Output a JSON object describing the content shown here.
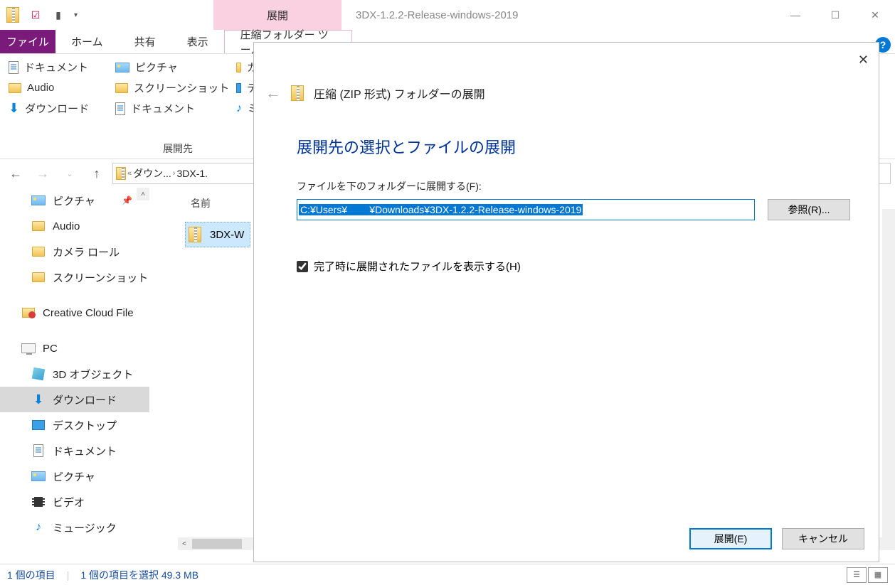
{
  "titlebar": {
    "contextual_tab": "展開",
    "window_title": "3DX-1.2.2-Release-windows-2019"
  },
  "ribbon": {
    "file_tab": "ファイル",
    "tabs": [
      "ホーム",
      "共有",
      "表示"
    ],
    "context_tab": "圧縮フォルダー ツール",
    "destinations": {
      "col1": [
        "ドキュメント",
        "Audio",
        "ダウンロード"
      ],
      "col2": [
        "ピクチャ",
        "スクリーンショット",
        "ドキュメント"
      ],
      "col3_cut": [
        "カ",
        "テ",
        "ミ"
      ]
    },
    "group_label": "展開先"
  },
  "breadcrumb": {
    "segments": [
      "ダウン... ",
      "3DX-1."
    ],
    "prefix": "«"
  },
  "tree": {
    "items": [
      {
        "label": "ピクチャ",
        "icon": "pic",
        "pinned": true,
        "root": false
      },
      {
        "label": "Audio",
        "icon": "folder",
        "root": false
      },
      {
        "label": "カメラ ロール",
        "icon": "folder",
        "root": false
      },
      {
        "label": "スクリーンショット",
        "icon": "folder",
        "root": false
      },
      {
        "label": "Creative Cloud File",
        "icon": "cc",
        "root": true,
        "spaced": true
      },
      {
        "label": "PC",
        "icon": "pc",
        "root": true,
        "spaced": true
      },
      {
        "label": "3D オブジェクト",
        "icon": "3d",
        "root": false
      },
      {
        "label": "ダウンロード",
        "icon": "down",
        "root": false,
        "selected": true
      },
      {
        "label": "デスクトップ",
        "icon": "desk",
        "root": false
      },
      {
        "label": "ドキュメント",
        "icon": "doc",
        "root": false
      },
      {
        "label": "ピクチャ",
        "icon": "pic",
        "root": false
      },
      {
        "label": "ビデオ",
        "icon": "vid",
        "root": false
      },
      {
        "label": "ミュージック",
        "icon": "music",
        "root": false
      }
    ]
  },
  "files": {
    "column_header": "名前",
    "row_name": "3DX-W"
  },
  "statusbar": {
    "count": "1 個の項目",
    "selection": "1 個の項目を選択 49.3 MB"
  },
  "dialog": {
    "title": "圧縮 (ZIP 形式) フォルダーの展開",
    "heading": "展開先の選択とファイルの展開",
    "field_label": "ファイルを下のフォルダーに展開する(F):",
    "path_value": "C:¥Users¥        ¥Downloads¥3DX-1.2.2-Release-windows-2019",
    "browse": "参照(R)...",
    "checkbox": "完了時に展開されたファイルを表示する(H)",
    "extract": "展開(E)",
    "cancel": "キャンセル"
  }
}
